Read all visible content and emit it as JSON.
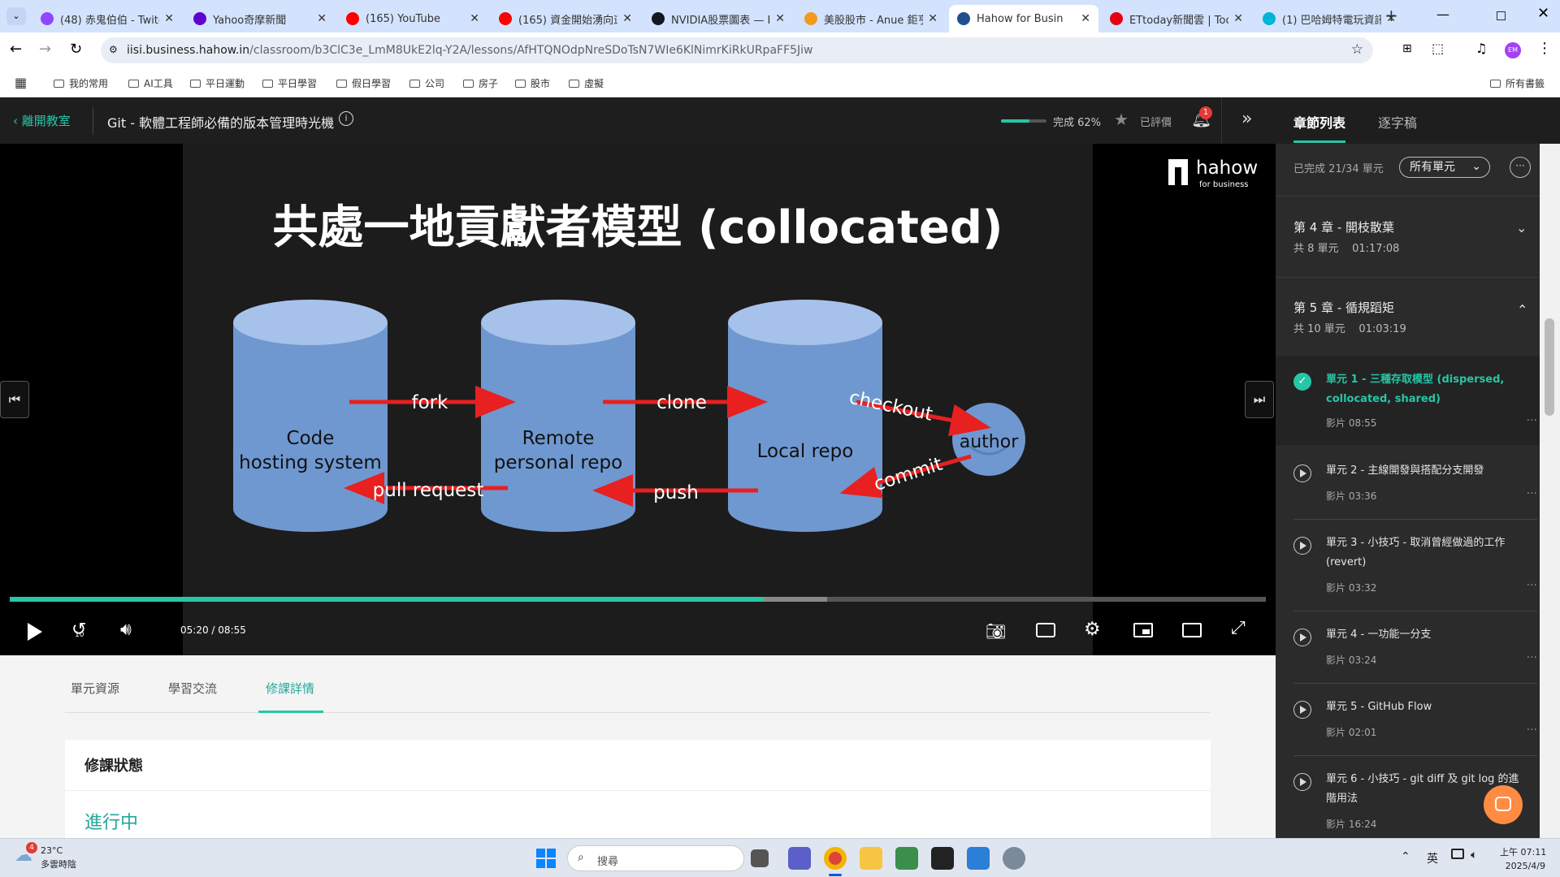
{
  "browser": {
    "tabs": [
      {
        "title": "(48) 赤鬼伯伯 - Twitc",
        "color": "#9146ff"
      },
      {
        "title": "Yahoo奇摩新聞",
        "color": "#6001d2"
      },
      {
        "title": "(165) YouTube",
        "color": "#ff0000"
      },
      {
        "title": "(165) 資金開始湧向這",
        "color": "#ff0000"
      },
      {
        "title": "NVIDIA股票圖表 — I",
        "color": "#131722"
      },
      {
        "title": "美股股市 - Anue 鉅亨",
        "color": "#f39a1e"
      },
      {
        "title": "Hahow for Busin",
        "color": "#1f4f8f",
        "active": true
      },
      {
        "title": "ETtoday新聞雲 | Tod",
        "color": "#e60012"
      },
      {
        "title": "(1) 巴哈姆特電玩資訊",
        "color": "#00b4d8"
      }
    ],
    "url_prefix": "iisi.business.hahow.in",
    "url_rest": "/classroom/b3ClC3e_LmM8UkE2lq-Y2A/lessons/AfHTQNOdpNreSDoTsN7WIe6KlNimrKiRkURpaFF5Jiw",
    "bookmarks": [
      "我的常用",
      "AI工具",
      "平日運動",
      "平日學習",
      "假日學習",
      "公司",
      "房子",
      "股市",
      "虛擬"
    ],
    "bookmarks_all": "所有書籤",
    "profile_initials": "EM"
  },
  "header": {
    "leave": "離開教室",
    "course_title": "Git - 軟體工程師必備的版本管理時光機",
    "progress_label": "完成 62%",
    "progress": 0.62,
    "rated": "已評價",
    "notif_count": "1"
  },
  "sidebar": {
    "tab_chapters": "章節列表",
    "tab_transcript": "逐字稿",
    "completed": "已完成 21/34 單元",
    "filter": "所有單元",
    "chapters": [
      {
        "title": "第 4 章 - 開枝散葉",
        "meta": "共 8 單元    01:17:08"
      },
      {
        "title": "第 5 章 - 循規蹈矩",
        "meta": "共 10 單元    01:03:19"
      }
    ],
    "units": [
      {
        "title": "單元 1 - 三種存取模型 (dispersed, collocated, shared)",
        "meta": "影片 08:55"
      },
      {
        "title": "單元 2 - 主線開發與搭配分支開發",
        "meta": "影片 03:36"
      },
      {
        "title": "單元 3 - 小技巧 - 取消曾經做過的工作 (revert)",
        "meta": "影片 03:32"
      },
      {
        "title": "單元 4 - 一功能一分支",
        "meta": "影片 03:24"
      },
      {
        "title": "單元 5 - GitHub Flow",
        "meta": "影片 02:01"
      },
      {
        "title": "單元 6 - 小技巧 - git diff 及 git log 的進階用法",
        "meta": "影片 16:24"
      }
    ]
  },
  "video": {
    "slide_title": "共處一地貢獻者模型 (collocated)",
    "db_code": [
      "Code",
      "hosting system"
    ],
    "db_remote": [
      "Remote",
      "personal repo"
    ],
    "db_local": "Local repo",
    "author": "author",
    "arrows": {
      "fork": "fork",
      "clone": "clone",
      "checkout": "checkout",
      "pull_request": "pull request",
      "push": "push",
      "commit": "commit"
    },
    "brand": "hahow",
    "brand_sub": "for business",
    "current": "05:20",
    "sep": "/",
    "total": "08:55",
    "played": 0.6,
    "buffered": 0.651
  },
  "lower": {
    "tabs": [
      "單元資源",
      "學習交流",
      "修課詳情"
    ],
    "card_title": "修課狀態",
    "status": "進行中"
  },
  "taskbar": {
    "weather_temp": "23°C",
    "weather_desc": "多雲時陰",
    "weather_badge": "4",
    "search": "搜尋",
    "ime": "英",
    "time": "上午 07:11",
    "date": "2025/4/9"
  }
}
